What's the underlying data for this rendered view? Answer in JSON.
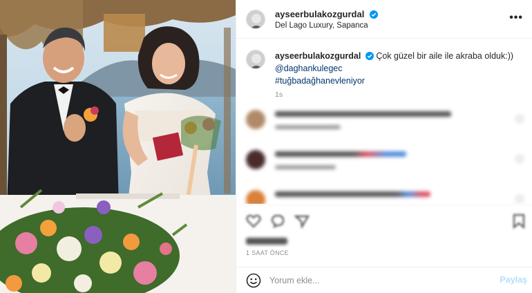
{
  "post": {
    "photo_alt": "",
    "author": {
      "username": "ayseerbulakozgurdal",
      "verified": true,
      "location": "Del Lago Luxury, Sapanca"
    },
    "more_icon": "more-horizontal-icon",
    "caption": {
      "username": "ayseerbulakozgurdal",
      "text": "Çok güzel bir aile ile akraba olduk:))",
      "mention": "@daghankulegec",
      "hashtag": "#tuğbadağhanevleniyor",
      "time": "1s"
    },
    "comments_blurred": 3,
    "actions": [
      "heart-icon",
      "comment-icon",
      "share-icon",
      "bookmark-icon"
    ],
    "likes_blurred": true,
    "post_time": "1 SAAT ÖNCE",
    "add_comment": {
      "placeholder": "Yorum ekle...",
      "button": "Paylaş"
    },
    "colors": {
      "verified_blue": "#0095f6",
      "link_blue": "#00376b",
      "post_button_disabled": "#b2dffc",
      "border": "#efefef"
    }
  }
}
